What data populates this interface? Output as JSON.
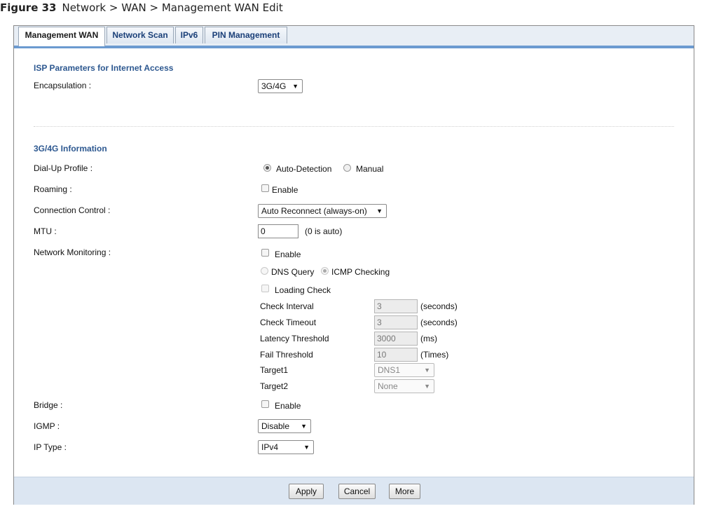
{
  "caption": {
    "figure": "Figure 33",
    "text": "Network > WAN > Management WAN Edit"
  },
  "tabs": [
    {
      "label": "Management WAN",
      "active": true
    },
    {
      "label": "Network Scan",
      "active": false
    },
    {
      "label": "IPv6",
      "active": false
    },
    {
      "label": "PIN Management",
      "active": false
    }
  ],
  "isp": {
    "title": "ISP Parameters for Internet Access",
    "encapsulation_label": "Encapsulation :",
    "encapsulation_value": "3G/4G"
  },
  "info": {
    "title": "3G/4G Information",
    "dialup_label": "Dial-Up Profile :",
    "dialup_auto": "Auto-Detection",
    "dialup_manual": "Manual",
    "roaming_label": "Roaming :",
    "roaming_enable": "Enable",
    "conn_label": "Connection Control :",
    "conn_value": "Auto Reconnect (always-on)",
    "mtu_label": "MTU :",
    "mtu_value": "0",
    "mtu_hint": "(0 is auto)",
    "monitor_label": "Network Monitoring :",
    "monitor_enable": "Enable",
    "dns_query": "DNS Query",
    "icmp_checking": "ICMP Checking",
    "loading_check": "Loading Check",
    "check_interval_label": "Check Interval",
    "check_interval_value": "3",
    "check_interval_unit": "(seconds)",
    "check_timeout_label": "Check Timeout",
    "check_timeout_value": "3",
    "check_timeout_unit": "(seconds)",
    "latency_label": "Latency Threshold",
    "latency_value": "3000",
    "latency_unit": "(ms)",
    "fail_label": "Fail Threshold",
    "fail_value": "10",
    "fail_unit": "(Times)",
    "target1_label": "Target1",
    "target1_value": "DNS1",
    "target2_label": "Target2",
    "target2_value": "None",
    "bridge_label": "Bridge :",
    "bridge_enable": "Enable",
    "igmp_label": "IGMP :",
    "igmp_value": "Disable",
    "iptype_label": "IP Type :",
    "iptype_value": "IPv4"
  },
  "footer": {
    "apply": "Apply",
    "cancel": "Cancel",
    "more": "More"
  }
}
